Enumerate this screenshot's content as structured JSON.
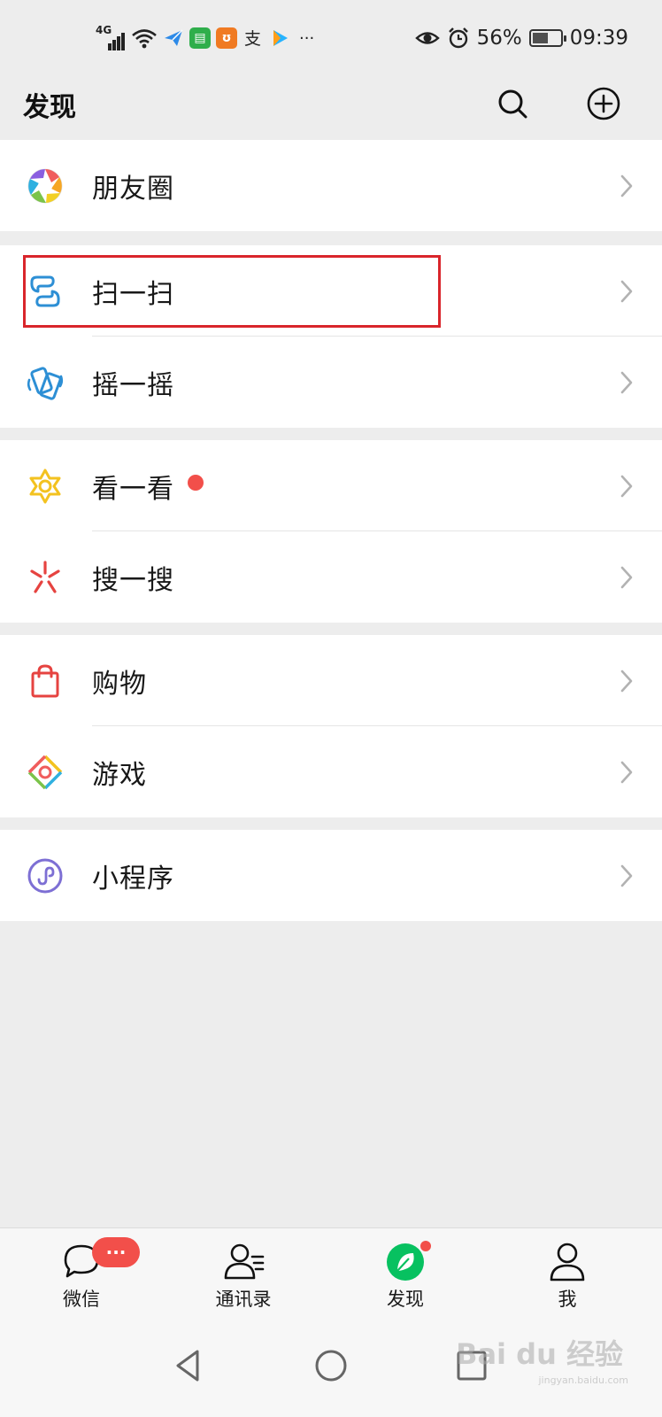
{
  "status_bar": {
    "network": "4G",
    "app_icons": [
      "paper-plane-app-icon",
      "green-app-icon",
      "uc-browser-icon",
      "alipay-icon",
      "video-app-icon"
    ],
    "more": "···",
    "battery": "56%",
    "battery_level": 0.56,
    "time": "09:39"
  },
  "header": {
    "title": "发现"
  },
  "groups": [
    {
      "items": [
        {
          "label": "朋友圈",
          "icon": "moments-icon"
        }
      ]
    },
    {
      "items": [
        {
          "label": "扫一扫",
          "icon": "scan-icon",
          "highlighted": true
        },
        {
          "label": "摇一摇",
          "icon": "shake-icon"
        }
      ]
    },
    {
      "items": [
        {
          "label": "看一看",
          "icon": "top-stories-icon",
          "red_dot": true
        },
        {
          "label": "搜一搜",
          "icon": "search-feature-icon"
        }
      ]
    },
    {
      "items": [
        {
          "label": "购物",
          "icon": "shopping-bag-icon"
        },
        {
          "label": "游戏",
          "icon": "games-icon"
        }
      ]
    },
    {
      "items": [
        {
          "label": "小程序",
          "icon": "mini-programs-icon"
        }
      ]
    }
  ],
  "tabbar": {
    "tabs": [
      {
        "label": "微信",
        "icon": "chat-icon",
        "badge": "···"
      },
      {
        "label": "通讯录",
        "icon": "contacts-icon"
      },
      {
        "label": "发现",
        "icon": "discover-compass-icon",
        "active": true,
        "dot": true
      },
      {
        "label": "我",
        "icon": "me-icon"
      }
    ]
  },
  "colors": {
    "accent_green": "#07c160",
    "badge_red": "#f24f4a",
    "highlight_red": "#d9252b",
    "background": "#ededed"
  },
  "watermark": {
    "brand": "Bai du 经验",
    "url": "jingyan.baidu.com"
  }
}
